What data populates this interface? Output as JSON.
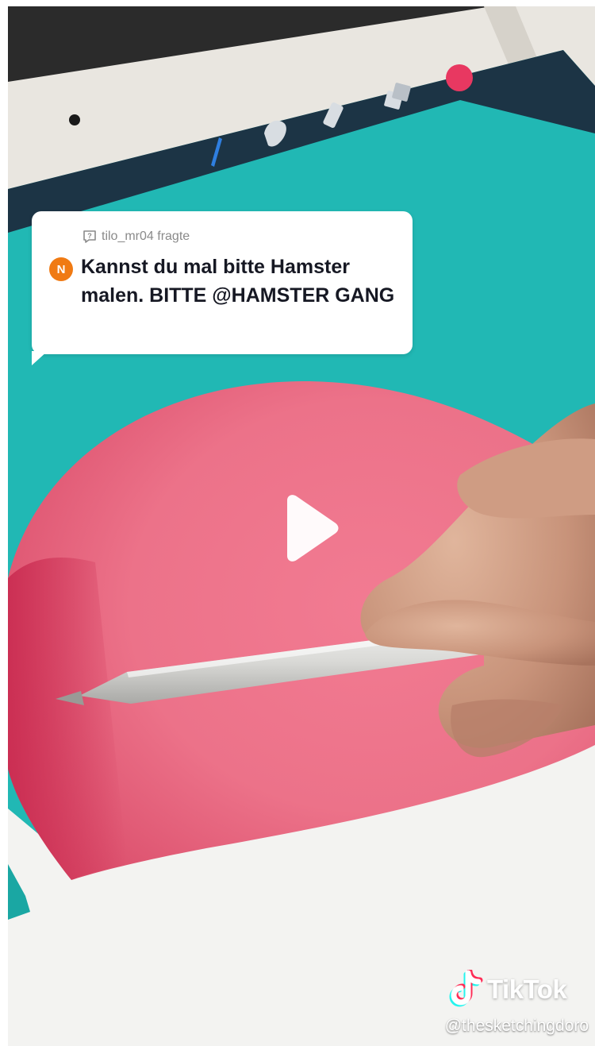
{
  "sticker": {
    "asker": "tilo_mr04 fragte",
    "avatar_initial": "N",
    "question": "Kannst du mal bitte Hamster malen. BITTE @HAMSTER GANG"
  },
  "watermark": {
    "brand": "TikTok",
    "handle": "@thesketchingdoro"
  },
  "icons": {
    "question": "question-bubble-icon",
    "play": "play-icon",
    "brand": "tiktok-note-icon",
    "toolbar": [
      "brush-icon",
      "smudge-icon",
      "eraser-icon",
      "layers-icon",
      "color-swatch-icon"
    ]
  },
  "colors": {
    "canvas_teal": "#21b8b4",
    "drawing_pink": "#e96d84",
    "avatar_orange": "#f07a13",
    "tablet_frame": "#e9e6e0",
    "toolbar_dark": "#1c3445",
    "active_brush": "#2f7fe0",
    "color_swatch": "#e83861"
  }
}
